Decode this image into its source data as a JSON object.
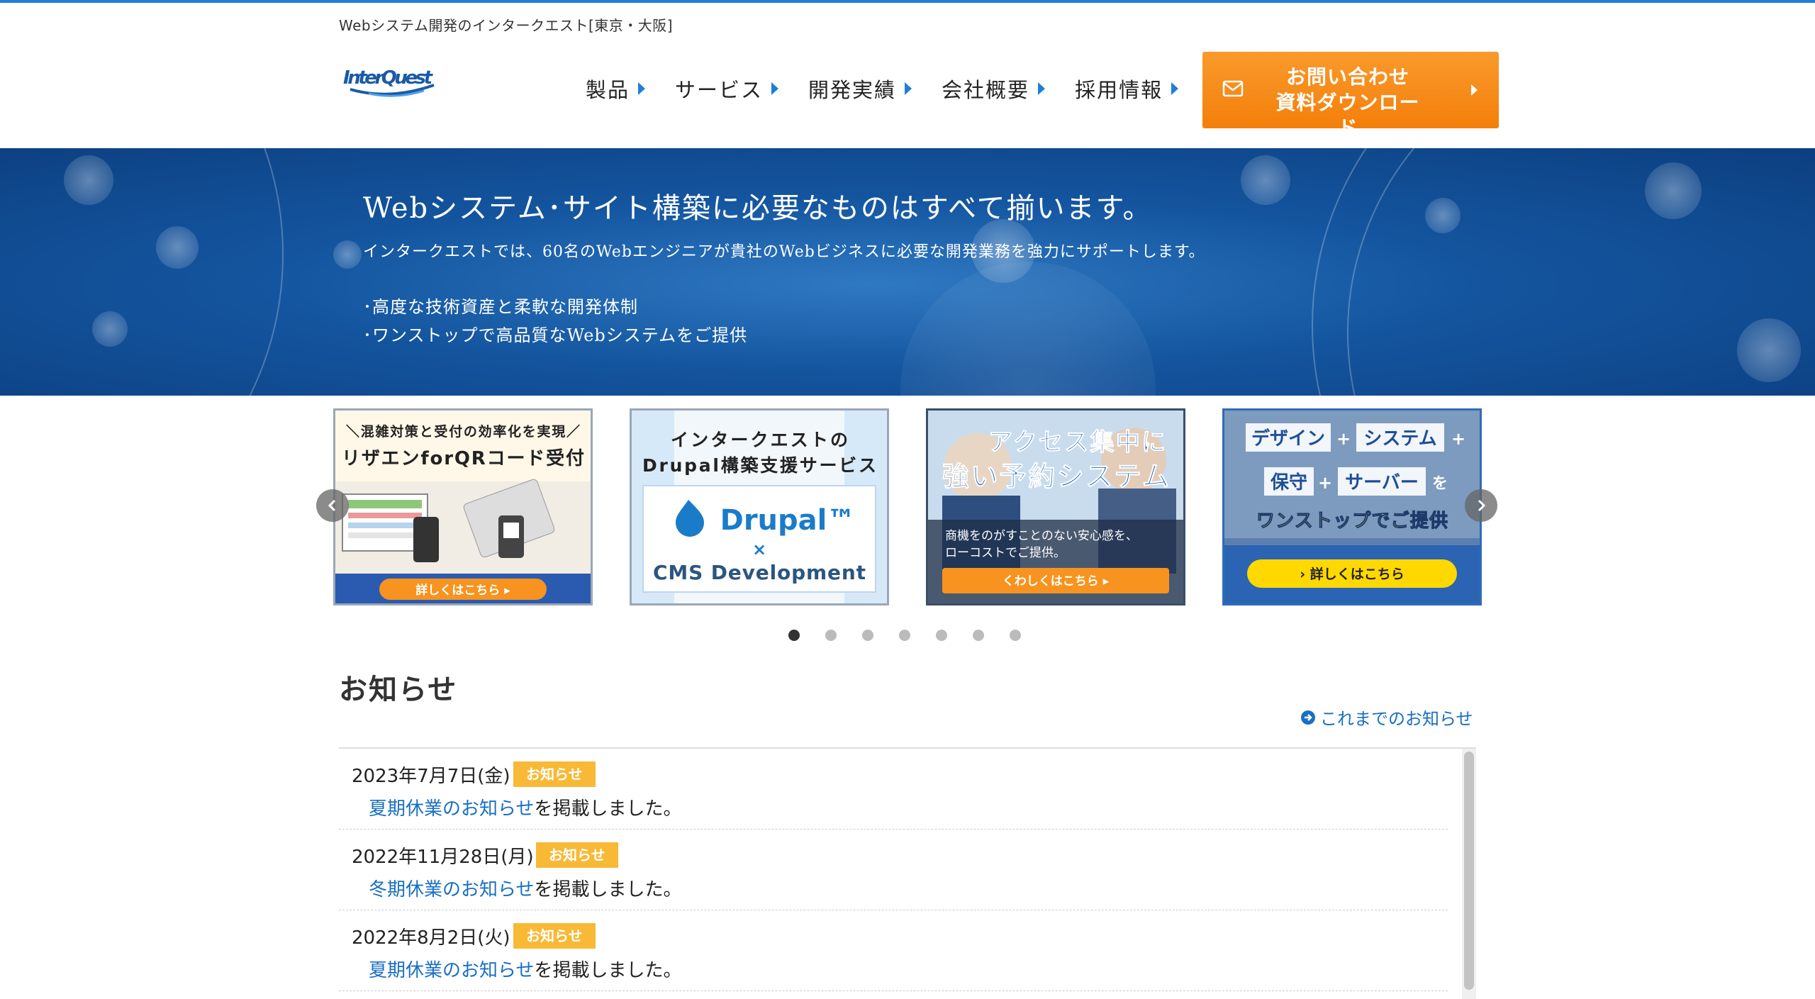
{
  "header": {
    "tagline": "Webシステム開発のインタークエスト[東京・大阪]",
    "logo_text": "InterQuest",
    "nav": [
      {
        "label": "製品"
      },
      {
        "label": "サービス"
      },
      {
        "label": "開発実績"
      },
      {
        "label": "会社概要"
      },
      {
        "label": "採用情報"
      }
    ],
    "cta": {
      "line1": "お問い合わせ",
      "line2": "資料ダウンロード"
    }
  },
  "hero": {
    "title": "Webシステム･サイト構築に必要なものはすべて揃います。",
    "subtitle": "インタークエストでは、60名のWebエンジニアが貴社のWebビジネスに必要な開発業務を強力にサポートします。",
    "bullets": [
      "･高度な技術資産と柔軟な開発体制",
      "･ワンストップで高品質なWebシステムをご提供"
    ]
  },
  "carousel": {
    "slides": [
      {
        "top": "＼混雑対策と受付の効率化を実現／",
        "title": "リザエンforQRコード受付",
        "button": "詳しくはこちら ▸"
      },
      {
        "top": "インタークエストの",
        "title": "Drupal構築支援サービス",
        "logo": "Drupal™",
        "cross": "×",
        "footer": "CMS Development"
      },
      {
        "title1": "アクセス集中に",
        "title2": "強い予約システム",
        "desc1": "商機をのがすことのない安心感を、",
        "desc2": "ローコストでご提供。",
        "button": "くわしくはこちら ▸"
      },
      {
        "row1a": "デザイン",
        "plus1": "+",
        "row1b": "システム",
        "plus2": "+",
        "row2a": "保守",
        "plus3": "+",
        "row2b": "サーバー",
        "wo": "を",
        "title": "ワンストップでご提供",
        "button": "›  詳しくはこちら"
      }
    ],
    "dot_count": 7,
    "active_dot": 0,
    "colors": {
      "accent": "#1f7fd6",
      "cta": "#f47f0a",
      "badge": "#f8b936"
    }
  },
  "news": {
    "title": "お知らせ",
    "archive_link": "これまでのお知らせ",
    "items": [
      {
        "date": "2023年7月7日(金)",
        "badge": "お知らせ",
        "link": "夏期休業のお知らせ",
        "suffix": "を掲載しました。"
      },
      {
        "date": "2022年11月28日(月)",
        "badge": "お知らせ",
        "link": "冬期休業のお知らせ",
        "suffix": "を掲載しました。"
      },
      {
        "date": "2022年8月2日(火)",
        "badge": "お知らせ",
        "link": "夏期休業のお知らせ",
        "suffix": "を掲載しました。"
      }
    ]
  }
}
